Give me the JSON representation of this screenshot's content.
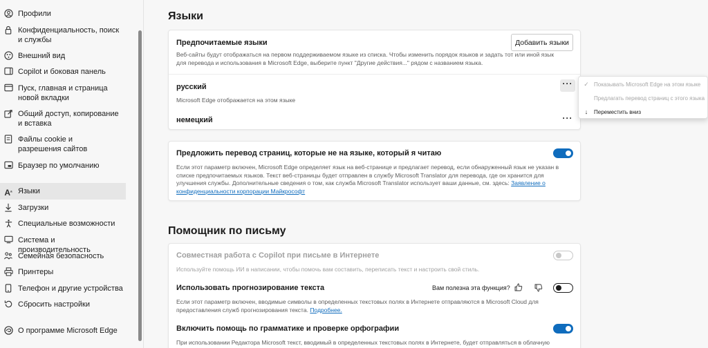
{
  "sidebar": {
    "items": [
      {
        "label": "Профили",
        "icon": "profile-icon"
      },
      {
        "label": "Конфиденциальность, поиск и службы",
        "icon": "lock-icon"
      },
      {
        "label": "Внешний вид",
        "icon": "appearance-icon"
      },
      {
        "label": "Copilot и боковая панель",
        "icon": "sidebar-icon"
      },
      {
        "label": "Пуск, главная и страница новой вкладки",
        "icon": "home-icon"
      },
      {
        "label": "Общий доступ, копирование и вставка",
        "icon": "share-icon"
      },
      {
        "label": "Файлы cookie и разрешения сайтов",
        "icon": "cookie-icon"
      },
      {
        "label": "Браузер по умолчанию",
        "icon": "browser-icon"
      },
      {
        "label": "Языки",
        "icon": "languages-icon"
      },
      {
        "label": "Загрузки",
        "icon": "download-icon"
      },
      {
        "label": "Специальные возможности",
        "icon": "accessibility-icon"
      },
      {
        "label": "Система и производительность",
        "icon": "system-icon"
      },
      {
        "label": "Семейная безопасность",
        "icon": "family-icon"
      },
      {
        "label": "Принтеры",
        "icon": "printer-icon"
      },
      {
        "label": "Телефон и другие устройства",
        "icon": "phone-icon"
      },
      {
        "label": "Сбросить настройки",
        "icon": "reset-icon"
      },
      {
        "label": "О программе Microsoft Edge",
        "icon": "edge-icon"
      }
    ]
  },
  "languages": {
    "title": "Языки",
    "preferred_title": "Предпочитаемые языки",
    "add_button": "Добавить языки",
    "preferred_desc": "Веб-сайты будут отображаться на первом поддерживаемом языке из списка. Чтобы изменить порядок языков и задать тот или иной язык для перевода и использования в Microsoft Edge, выберите пункт \"Другие действия...\" рядом с названием языка.",
    "list": [
      {
        "name": "русский",
        "note": "Microsoft Edge отображается на этом языке"
      },
      {
        "name": "немецкий",
        "note": ""
      }
    ],
    "translate_title": "Предложить перевод страниц, которые не на языке, который я читаю",
    "translate_desc": "Если этот параметр включен, Microsoft Edge определяет язык на веб-странице и предлагает перевод, если обнаруженный язык не указан в списке предпочитаемых языков. Текст веб-страницы будет отправлен в службу Microsoft Translator для перевода, где он хранится для улучшения службы. Дополнительные сведения о том, как служба Microsoft Translator использует ваши данные, см. здесь:",
    "translate_link": "Заявление о конфиденциальности корпорации Майкрософт",
    "translate_enabled": true
  },
  "writing": {
    "title": "Помощник по письму",
    "copilot_title": "Совместная работа с Copilot при письме в Интернете",
    "copilot_desc": "Используйте помощь ИИ в написании, чтобы помочь вам составить, переписать текст и настроить свой стиль.",
    "copilot_enabled": false,
    "prediction_title": "Использовать прогнозирование текста",
    "feedback_question": "Вам полезна эта функция?",
    "prediction_desc": "Если этот параметр включен, вводимые символы в определенных текстовых полях в Интернете отправляются в Microsoft Cloud для предоставления служб прогнозирования текста.",
    "prediction_link": "Подробнее.",
    "prediction_enabled": false,
    "grammar_title": "Включить помощь по грамматике и проверке орфографии",
    "grammar_desc": "При использовании Редактора Microsoft текст, вводимый в определенных текстовых полях в Интернете, будет отправляться в облачную",
    "grammar_enabled": true
  },
  "context_menu": {
    "items": [
      {
        "label": "Показывать Microsoft Edge на этом языке",
        "icon": "check-icon",
        "enabled": false
      },
      {
        "label": "Предлагать перевод страниц с этого языка",
        "icon": "",
        "enabled": false
      },
      {
        "label": "Переместить вниз",
        "icon": "arrow-down-icon",
        "enabled": true
      }
    ]
  },
  "colors": {
    "accent": "#0f6cbd",
    "card_bg": "#ffffff",
    "page_bg": "#f7f7f7"
  }
}
